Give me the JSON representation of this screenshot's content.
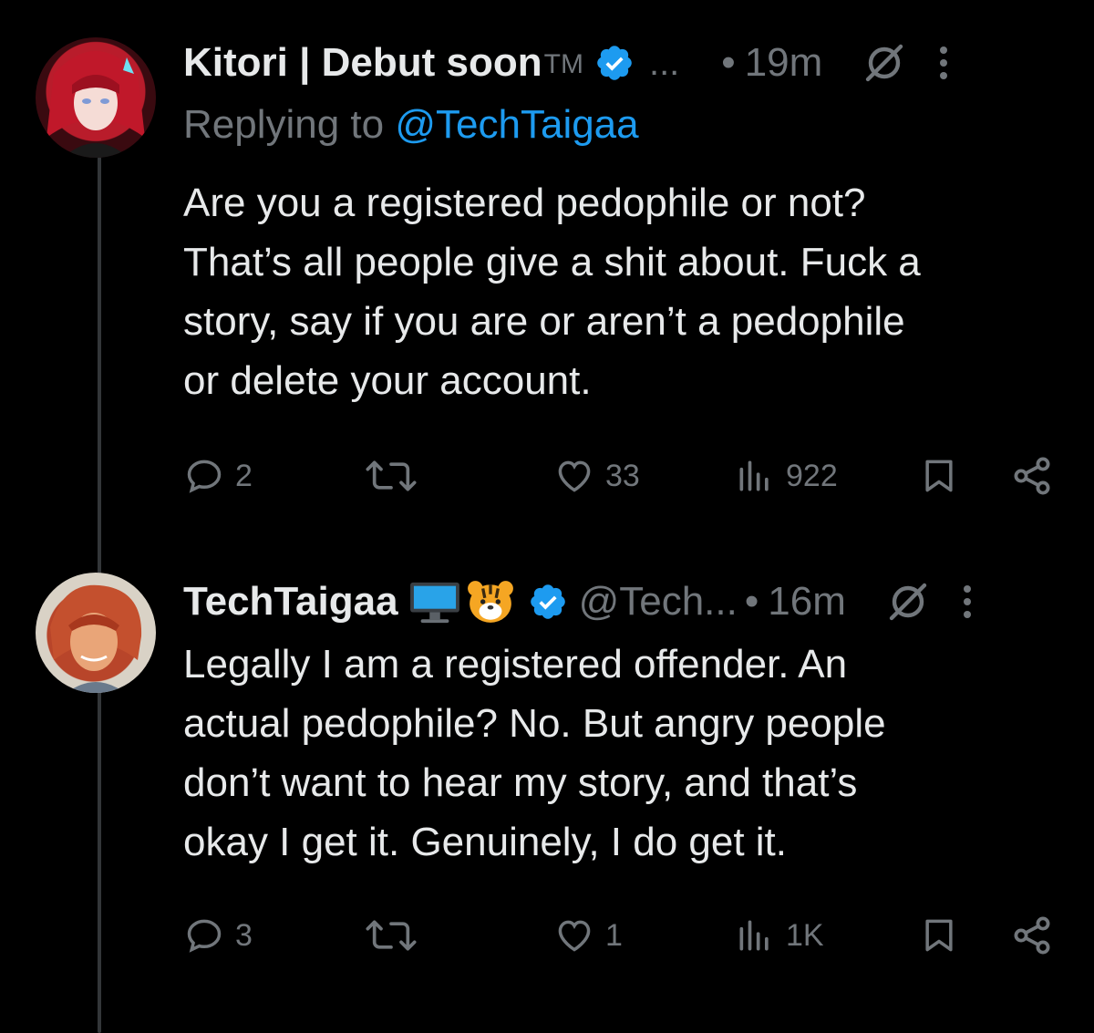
{
  "tweets": [
    {
      "display_name": "Kitori | Debut soon",
      "name_suffix": "TM",
      "header_more": "...",
      "dot": "•",
      "time": "19m",
      "replying_prefix": "Replying to ",
      "replying_to": "@TechTaigaa",
      "body_lines": [
        "Are you a registered pedophile or not?",
        "That’s all people give a shit about. Fuck a",
        "story, say if you are or aren’t a pedophile",
        "or delete your account."
      ],
      "stats": {
        "replies": "2",
        "reposts": "",
        "likes": "33",
        "views": "922"
      }
    },
    {
      "display_name": "TechTaigaa",
      "handle": "@Tech...",
      "dot": "•",
      "time": "16m",
      "emojis": [
        "computer-monitor-emoji",
        "tiger-face-emoji"
      ],
      "body_lines": [
        "Legally I am a registered offender. An",
        "actual pedophile? No. But angry people",
        "don’t want to hear my story, and that’s",
        "okay I get it. Genuinely, I do get it."
      ],
      "stats": {
        "replies": "3",
        "reposts": "",
        "likes": "1",
        "views": "1K"
      }
    }
  ],
  "colors": {
    "background": "#000000",
    "text": "#e7e9ea",
    "secondary": "#71767b",
    "accent": "#1d9bf0",
    "thread_line": "#333639"
  },
  "icons": [
    "verified-badge-icon",
    "grok-icon",
    "more-icon",
    "reply-icon",
    "repost-icon",
    "like-icon",
    "views-icon",
    "bookmark-icon",
    "share-icon"
  ]
}
